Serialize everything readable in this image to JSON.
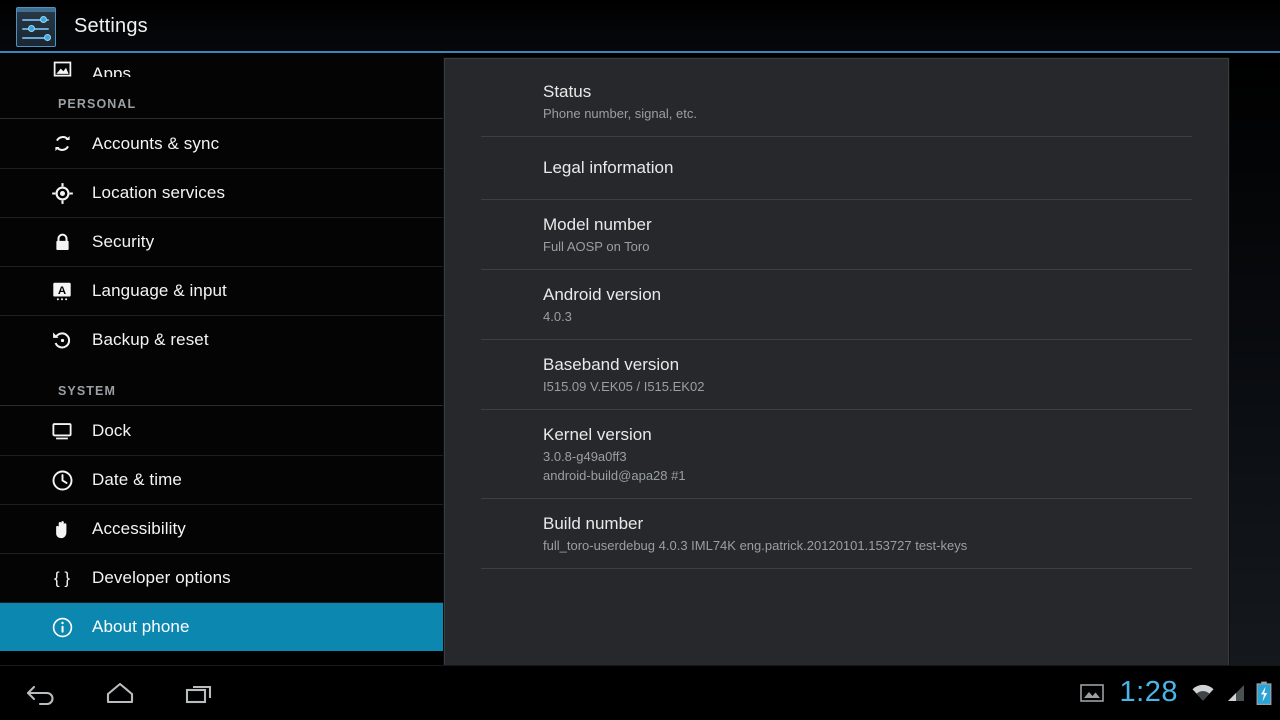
{
  "app": {
    "title": "Settings",
    "icon": "settings-sliders-icon",
    "accent_color": "#0c87b0",
    "divider_color": "#3b86b5"
  },
  "sidebar": {
    "clipped_top_item": {
      "label": "Apps",
      "icon": "apps-icon"
    },
    "sections": [
      {
        "header": "PERSONAL",
        "items": [
          {
            "label": "Accounts & sync",
            "icon": "sync-icon",
            "selected": false
          },
          {
            "label": "Location services",
            "icon": "location-crosshair-icon",
            "selected": false
          },
          {
            "label": "Security",
            "icon": "lock-icon",
            "selected": false
          },
          {
            "label": "Language & input",
            "icon": "letter-a-keyboard-icon",
            "selected": false
          },
          {
            "label": "Backup & reset",
            "icon": "backup-restore-icon",
            "selected": false
          }
        ]
      },
      {
        "header": "SYSTEM",
        "items": [
          {
            "label": "Dock",
            "icon": "monitor-dock-icon",
            "selected": false
          },
          {
            "label": "Date & time",
            "icon": "clock-icon",
            "selected": false
          },
          {
            "label": "Accessibility",
            "icon": "hand-icon",
            "selected": false
          },
          {
            "label": "Developer options",
            "icon": "braces-icon",
            "selected": false
          },
          {
            "label": "About phone",
            "icon": "info-circle-icon",
            "selected": true
          }
        ]
      }
    ]
  },
  "content": {
    "preferences": [
      {
        "title": "Status",
        "summary": "Phone number, signal, etc.",
        "summary2": ""
      },
      {
        "title": "Legal information",
        "summary": "",
        "summary2": ""
      },
      {
        "title": "Model number",
        "summary": "Full AOSP on Toro",
        "summary2": ""
      },
      {
        "title": "Android version",
        "summary": "4.0.3",
        "summary2": ""
      },
      {
        "title": "Baseband version",
        "summary": "I515.09 V.EK05 / I515.EK02",
        "summary2": ""
      },
      {
        "title": "Kernel version",
        "summary": "3.0.8-g49a0ff3",
        "summary2": "android-build@apa28 #1"
      },
      {
        "title": "Build number",
        "summary": "full_toro-userdebug 4.0.3 IML74K eng.patrick.20120101.153727 test-keys",
        "summary2": ""
      }
    ]
  },
  "systembar": {
    "nav": [
      {
        "name": "back",
        "icon": "back-arrow-icon"
      },
      {
        "name": "home",
        "icon": "home-icon"
      },
      {
        "name": "recents",
        "icon": "recent-apps-icon"
      }
    ],
    "status": {
      "screenshot_icon": "image-screenshot-icon",
      "clock": "1:28",
      "clock_color": "#49b5e8",
      "wifi_icon": "wifi-icon",
      "signal_icon": "cell-signal-icon",
      "battery_icon": "battery-charging-icon"
    }
  }
}
